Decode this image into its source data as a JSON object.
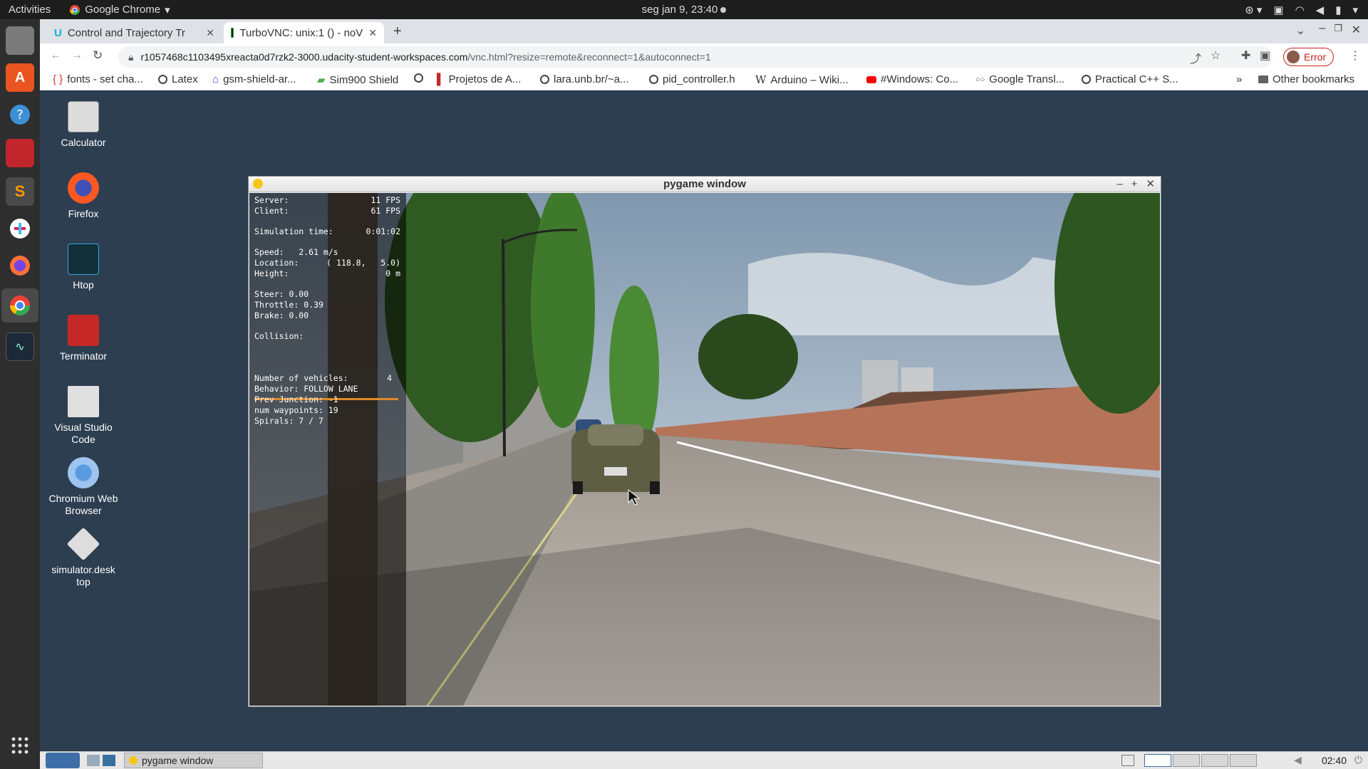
{
  "topbar": {
    "activities": "Activities",
    "app_name": "Google Chrome",
    "clock": "seg jan  9, 23:40"
  },
  "browser": {
    "tabs": [
      {
        "title": "Control and Trajectory Tr",
        "active": false
      },
      {
        "title": "TurboVNC: unix:1 () - noV",
        "active": true
      }
    ],
    "url_host": "r1057468c1103495xreacta0d7rzk2-3000.udacity-student-workspaces.com",
    "url_path": "/vnc.html?resize=remote&reconnect=1&autoconnect=1",
    "profile_status": "Error",
    "bookmarks": [
      "fonts - set cha...",
      "Latex",
      "gsm-shield-ar...",
      "Sim900 Shield",
      "",
      "Projetos de A...",
      "lara.unb.br/~a...",
      "pid_controller.h",
      "Arduino – Wiki...",
      "#Windows: Co...",
      "Google Transl...",
      "Practical C++ S..."
    ],
    "other_bookmarks": "Other bookmarks",
    "more": "»"
  },
  "desktop_icons": [
    {
      "label": "Calculator"
    },
    {
      "label": "Firefox"
    },
    {
      "label": "Htop"
    },
    {
      "label": "Terminator"
    },
    {
      "label": "Visual Studio Code"
    },
    {
      "label": "Chromium Web Browser"
    },
    {
      "label": "simulator.desk top"
    }
  ],
  "pygame": {
    "title": "pygame window",
    "hud": {
      "server_label": "Server:",
      "server_value": "11 FPS",
      "client_label": "Client:",
      "client_value": "61 FPS",
      "simtime_label": "Simulation time:",
      "simtime_value": "0:01:02",
      "speed": "Speed:   2.61 m/s",
      "location_label": "Location:",
      "location_value": "( 118.8,   5.0)",
      "height_label": "Height:",
      "height_value": "0 m",
      "steer": "Steer: 0.00",
      "throttle": "Throttle: 0.39",
      "brake": "Brake: 0.00",
      "collision": "Collision:",
      "vehicles_label": "Number of vehicles:",
      "vehicles_value": "4",
      "behavior": "Behavior: FOLLOW LANE",
      "prev_junction": "Prev Junction: -1",
      "num_waypoints": "num waypoints: 19",
      "spirals": "Spirals: 7 / 7"
    }
  },
  "panel": {
    "task_label": "pygame window",
    "clock": "02:40"
  }
}
